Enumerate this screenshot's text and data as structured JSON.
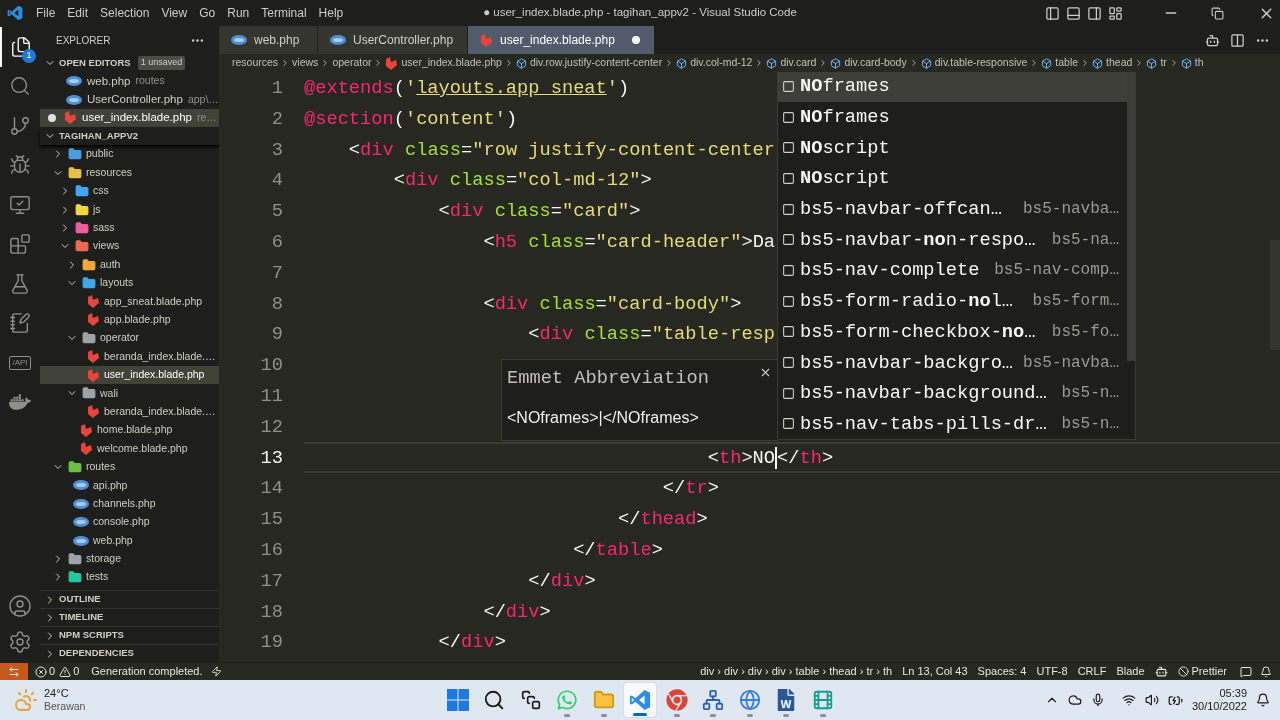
{
  "title_bar": {
    "menu": [
      "File",
      "Edit",
      "Selection",
      "View",
      "Go",
      "Run",
      "Terminal",
      "Help"
    ],
    "title": "● user_index.blade.php - tagihan_appv2 - Visual Studio Code"
  },
  "activity_bar": {
    "items": [
      {
        "kind": "explorer",
        "selected": true,
        "badge": "1"
      },
      {
        "kind": "search",
        "selected": false
      },
      {
        "kind": "source-control",
        "selected": false
      },
      {
        "kind": "run-debug",
        "selected": false
      },
      {
        "kind": "remote",
        "selected": false
      },
      {
        "kind": "extensions",
        "selected": false
      },
      {
        "kind": "testing",
        "selected": false
      },
      {
        "kind": "notebook",
        "selected": false
      },
      {
        "kind": "api",
        "selected": false,
        "label": "/API"
      },
      {
        "kind": "docker",
        "selected": false
      }
    ],
    "bottom": [
      {
        "kind": "account"
      },
      {
        "kind": "settings"
      }
    ]
  },
  "sidebar": {
    "title": "EXPLORER",
    "open_editors": {
      "title": "OPEN EDITORS",
      "expanded": true,
      "badge": "1 unsaved",
      "items": [
        {
          "name": "web.php",
          "description": "routes",
          "kind": "php-file",
          "modified": false,
          "selected": false
        },
        {
          "name": "UserController.php",
          "description": "app\\…",
          "kind": "php-file",
          "modified": false,
          "selected": false
        },
        {
          "name": "user_index.blade.php",
          "description": "re…",
          "kind": "blade-file",
          "modified": true,
          "selected": true
        }
      ]
    },
    "project": {
      "title": "TAGIHAN_APPV2",
      "expanded": true,
      "tree": [
        {
          "name": "public",
          "kind": "folder",
          "color": "#4a9ee0",
          "expanded": false,
          "selected": false
        },
        {
          "name": "resources",
          "kind": "folder",
          "color": "#e8c14a",
          "expanded": true,
          "selected": false,
          "children": [
            {
              "name": "css",
              "kind": "folder",
              "color": "#42a5f5",
              "expanded": false,
              "selected": false
            },
            {
              "name": "js",
              "kind": "folder",
              "color": "#f5d442",
              "expanded": false,
              "selected": false
            },
            {
              "name": "sass",
              "kind": "folder",
              "color": "#ec5f9c",
              "expanded": false,
              "selected": false
            },
            {
              "name": "views",
              "kind": "folder",
              "color": "#ef6a4c",
              "expanded": true,
              "selected": false,
              "children": [
                {
                  "name": "auth",
                  "kind": "folder",
                  "color": "#f2a93b",
                  "expanded": false,
                  "selected": false
                },
                {
                  "name": "layouts",
                  "kind": "folder",
                  "color": "#3fa9e8",
                  "expanded": true,
                  "selected": false,
                  "children": [
                    {
                      "name": "app_sneat.blade.php",
                      "kind": "blade-file",
                      "selected": false
                    },
                    {
                      "name": "app.blade.php",
                      "kind": "blade-file",
                      "selected": false
                    }
                  ]
                },
                {
                  "name": "operator",
                  "kind": "folder",
                  "color": "#9ea3a8",
                  "expanded": true,
                  "selected": false,
                  "children": [
                    {
                      "name": "beranda_index.blade.…",
                      "kind": "blade-file",
                      "selected": false
                    },
                    {
                      "name": "user_index.blade.php",
                      "kind": "blade-file",
                      "selected": true
                    }
                  ]
                },
                {
                  "name": "wali",
                  "kind": "folder",
                  "color": "#9ea3a8",
                  "expanded": true,
                  "selected": false,
                  "children": [
                    {
                      "name": "beranda_index.blade.…",
                      "kind": "blade-file",
                      "selected": false
                    }
                  ]
                },
                {
                  "name": "home.blade.php",
                  "kind": "blade-file",
                  "selected": false
                },
                {
                  "name": "welcome.blade.php",
                  "kind": "blade-file",
                  "selected": false
                }
              ]
            }
          ]
        },
        {
          "name": "routes",
          "kind": "folder",
          "color": "#6cbf43",
          "expanded": true,
          "selected": false,
          "children": [
            {
              "name": "api.php",
              "kind": "php-file",
              "selected": false
            },
            {
              "name": "channels.php",
              "kind": "php-file",
              "selected": false
            },
            {
              "name": "console.php",
              "kind": "php-file",
              "selected": false
            },
            {
              "name": "web.php",
              "kind": "php-file",
              "selected": false
            }
          ]
        },
        {
          "name": "storage",
          "kind": "folder",
          "color": "#9ea3a8",
          "expanded": false,
          "selected": false
        },
        {
          "name": "tests",
          "kind": "folder",
          "color": "#26c6a0",
          "expanded": false,
          "selected": false
        }
      ]
    },
    "sections": [
      {
        "title": "OUTLINE",
        "expanded": false
      },
      {
        "title": "TIMELINE",
        "expanded": false
      },
      {
        "title": "NPM SCRIPTS",
        "expanded": false
      },
      {
        "title": "DEPENDENCIES",
        "expanded": false
      }
    ]
  },
  "editor": {
    "tabs": [
      {
        "name": "web.php",
        "kind": "php-file",
        "selected": false,
        "modified": false
      },
      {
        "name": "UserController.php",
        "kind": "php-file",
        "selected": false,
        "modified": false
      },
      {
        "name": "user_index.blade.php",
        "kind": "blade-file",
        "selected": true,
        "modified": true
      }
    ],
    "breadcrumb": [
      {
        "text": "resources",
        "kind": "folder"
      },
      {
        "text": "views",
        "kind": "folder"
      },
      {
        "text": "operator",
        "kind": "folder"
      },
      {
        "text": "user_index.blade.php",
        "kind": "file"
      },
      {
        "text": "div.row.justify-content-center",
        "kind": "element"
      },
      {
        "text": "div.col-md-12",
        "kind": "element"
      },
      {
        "text": "div.card",
        "kind": "element"
      },
      {
        "text": "div.card-body",
        "kind": "element"
      },
      {
        "text": "div.table-responsive",
        "kind": "element"
      },
      {
        "text": "table",
        "kind": "element"
      },
      {
        "text": "thead",
        "kind": "element"
      },
      {
        "text": "tr",
        "kind": "element"
      },
      {
        "text": "th",
        "kind": "element"
      }
    ],
    "lines": [
      {
        "number": "1",
        "current": false,
        "tokens": [
          {
            "kind": "directive",
            "text": "@extends"
          },
          {
            "kind": "punct",
            "text": "("
          },
          {
            "kind": "string",
            "text": "'"
          },
          {
            "kind": "link",
            "text": "layouts.app_sneat"
          },
          {
            "kind": "string",
            "text": "'"
          },
          {
            "kind": "punct",
            "text": ")"
          }
        ]
      },
      {
        "number": "2",
        "current": false,
        "tokens": [
          {
            "kind": "directive",
            "text": "@section"
          },
          {
            "kind": "punct",
            "text": "("
          },
          {
            "kind": "string",
            "text": "'content'"
          },
          {
            "kind": "punct",
            "text": ")"
          }
        ]
      },
      {
        "number": "3",
        "current": false,
        "tokens": [
          {
            "kind": "punct",
            "text": "    <"
          },
          {
            "kind": "tag",
            "text": "div"
          },
          {
            "kind": "attr",
            "text": " class"
          },
          {
            "kind": "punct",
            "text": "="
          },
          {
            "kind": "string",
            "text": "\"row justify-content-center"
          }
        ]
      },
      {
        "number": "4",
        "current": false,
        "tokens": [
          {
            "kind": "punct",
            "text": "        <"
          },
          {
            "kind": "tag",
            "text": "div"
          },
          {
            "kind": "attr",
            "text": " class"
          },
          {
            "kind": "punct",
            "text": "="
          },
          {
            "kind": "string",
            "text": "\"col-md-12\""
          },
          {
            "kind": "punct",
            "text": ">"
          }
        ]
      },
      {
        "number": "5",
        "current": false,
        "tokens": [
          {
            "kind": "punct",
            "text": "            <"
          },
          {
            "kind": "tag",
            "text": "div"
          },
          {
            "kind": "attr",
            "text": " class"
          },
          {
            "kind": "punct",
            "text": "="
          },
          {
            "kind": "string",
            "text": "\"card\""
          },
          {
            "kind": "punct",
            "text": ">"
          }
        ]
      },
      {
        "number": "6",
        "current": false,
        "tokens": [
          {
            "kind": "punct",
            "text": "                <"
          },
          {
            "kind": "tag",
            "text": "h5"
          },
          {
            "kind": "attr",
            "text": " class"
          },
          {
            "kind": "punct",
            "text": "="
          },
          {
            "kind": "string",
            "text": "\"card-header\""
          },
          {
            "kind": "punct",
            "text": ">"
          },
          {
            "kind": "text",
            "text": "Da"
          }
        ]
      },
      {
        "number": "7",
        "current": false
      },
      {
        "number": "8",
        "current": false,
        "tokens": [
          {
            "kind": "punct",
            "text": "                <"
          },
          {
            "kind": "tag",
            "text": "div"
          },
          {
            "kind": "attr",
            "text": " class"
          },
          {
            "kind": "punct",
            "text": "="
          },
          {
            "kind": "string",
            "text": "\"card-body\""
          },
          {
            "kind": "punct",
            "text": ">"
          }
        ]
      },
      {
        "number": "9",
        "current": false,
        "tokens": [
          {
            "kind": "punct",
            "text": "                    <"
          },
          {
            "kind": "tag",
            "text": "div"
          },
          {
            "kind": "attr",
            "text": " class"
          },
          {
            "kind": "punct",
            "text": "="
          },
          {
            "kind": "string",
            "text": "\"table-resp"
          }
        ]
      },
      {
        "number": "10",
        "current": false
      },
      {
        "number": "11",
        "current": false
      },
      {
        "number": "12",
        "current": false
      },
      {
        "number": "13",
        "current": true,
        "tokens": [
          {
            "kind": "punct",
            "text": "                                    <"
          },
          {
            "kind": "tag",
            "text": "th"
          },
          {
            "kind": "punct",
            "text": ">"
          },
          {
            "kind": "text",
            "text": "NO"
          },
          {
            "kind": "cursor"
          },
          {
            "kind": "punct",
            "text": "</"
          },
          {
            "kind": "tag",
            "text": "th"
          },
          {
            "kind": "punct",
            "text": ">"
          }
        ]
      },
      {
        "number": "14",
        "current": false,
        "tokens": [
          {
            "kind": "punct",
            "text": "                                </"
          },
          {
            "kind": "tag",
            "text": "tr"
          },
          {
            "kind": "punct",
            "text": ">"
          }
        ]
      },
      {
        "number": "15",
        "current": false,
        "tokens": [
          {
            "kind": "punct",
            "text": "                            </"
          },
          {
            "kind": "tag",
            "text": "thead"
          },
          {
            "kind": "punct",
            "text": ">"
          }
        ]
      },
      {
        "number": "16",
        "current": false,
        "tokens": [
          {
            "kind": "punct",
            "text": "                        </"
          },
          {
            "kind": "tag",
            "text": "table"
          },
          {
            "kind": "punct",
            "text": ">"
          }
        ]
      },
      {
        "number": "17",
        "current": false,
        "tokens": [
          {
            "kind": "punct",
            "text": "                    </"
          },
          {
            "kind": "tag",
            "text": "div"
          },
          {
            "kind": "punct",
            "text": ">"
          }
        ]
      },
      {
        "number": "18",
        "current": false,
        "tokens": [
          {
            "kind": "punct",
            "text": "                </"
          },
          {
            "kind": "tag",
            "text": "div"
          },
          {
            "kind": "punct",
            "text": ">"
          }
        ]
      },
      {
        "number": "19",
        "current": false,
        "tokens": [
          {
            "kind": "punct",
            "text": "            </"
          },
          {
            "kind": "tag",
            "text": "div"
          },
          {
            "kind": "punct",
            "text": ">"
          }
        ]
      }
    ],
    "suggestions": [
      {
        "label": "**NO**frames",
        "selected": true
      },
      {
        "label": "**NO**frames",
        "selected": false
      },
      {
        "label": "**NO**script",
        "selected": false
      },
      {
        "label": "**NO**script",
        "selected": false
      },
      {
        "label": "bs5-navbar-offcan…",
        "detail": "bs5-navba…",
        "selected": false
      },
      {
        "label": "bs5-navbar-**no**n-respo…",
        "detail": "bs5-na…",
        "selected": false
      },
      {
        "label": "bs5-nav-complete",
        "detail": "bs5-nav-comp…",
        "selected": false
      },
      {
        "label": "bs5-form-radio-**no**l…",
        "detail": "bs5-form…",
        "selected": false
      },
      {
        "label": "bs5-form-checkbox-**no**…",
        "detail": "bs5-fo…",
        "selected": false
      },
      {
        "label": "bs5-navbar-backgro…",
        "detail": "bs5-navba…",
        "selected": false
      },
      {
        "label": "bs5-navbar-background…",
        "detail": "bs5-n…",
        "selected": false
      },
      {
        "label": "bs5-nav-tabs-pills-dr…",
        "detail": "bs5-n…",
        "selected": false
      }
    ],
    "emmet_preview": {
      "title": "Emmet Abbreviation",
      "content": "<NOframes>|</NOframes>"
    }
  },
  "status_bar": {
    "errors": "0",
    "warnings": "0",
    "message": "Generation completed.",
    "items": [
      "div › div › div › div › table › thead › tr › th",
      "Ln 13, Col 43",
      "Spaces: 4",
      "UTF-8",
      "CRLF",
      "Blade"
    ],
    "formatter": "Prettier"
  },
  "taskbar": {
    "weather": {
      "temperature": "24°C",
      "condition": "Berawan"
    },
    "apps": [
      {
        "kind": "start",
        "running": false,
        "selected": false
      },
      {
        "kind": "search",
        "running": false,
        "selected": false
      },
      {
        "kind": "task-view",
        "running": false,
        "selected": false
      },
      {
        "kind": "chat",
        "running": true,
        "selected": false
      },
      {
        "kind": "files",
        "running": true,
        "selected": false
      },
      {
        "kind": "code-editor",
        "running": true,
        "selected": true
      },
      {
        "kind": "browser",
        "running": true,
        "selected": false
      },
      {
        "kind": "network",
        "running": true,
        "selected": false
      },
      {
        "kind": "globe",
        "running": true,
        "selected": false
      },
      {
        "kind": "word",
        "running": true,
        "selected": false
      },
      {
        "kind": "video",
        "running": true,
        "selected": false
      }
    ],
    "clock": {
      "time": "05:39",
      "date": "30/10/2022"
    }
  }
}
